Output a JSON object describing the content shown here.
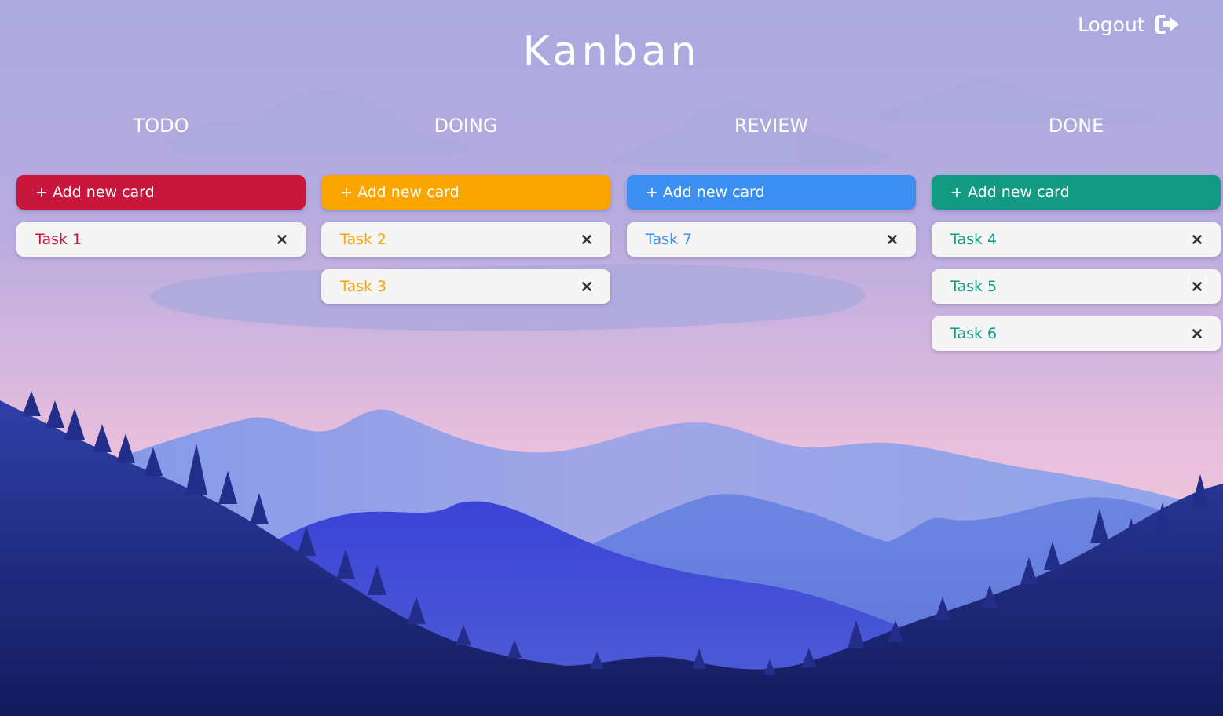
{
  "app": {
    "title": "Kanban"
  },
  "header": {
    "logout_label": "Logout",
    "logout_icon": "sign-out-icon"
  },
  "colors": {
    "todo": "#c8163c",
    "doing": "#fba500",
    "review": "#3c8ff0",
    "done": "#139a83",
    "card_bg": "#f5f5f5",
    "close": "#333333"
  },
  "columns": [
    {
      "title": "TODO",
      "add_label": "+ Add new card",
      "cards": [
        {
          "label": "Task 1"
        }
      ]
    },
    {
      "title": "DOING",
      "add_label": "+ Add new card",
      "cards": [
        {
          "label": "Task 2"
        },
        {
          "label": "Task 3"
        }
      ]
    },
    {
      "title": "REVIEW",
      "add_label": "+ Add new card",
      "cards": [
        {
          "label": "Task 7"
        }
      ]
    },
    {
      "title": "DONE",
      "add_label": "+ Add new card",
      "cards": [
        {
          "label": "Task 4"
        },
        {
          "label": "Task 5"
        },
        {
          "label": "Task 6"
        }
      ]
    }
  ]
}
